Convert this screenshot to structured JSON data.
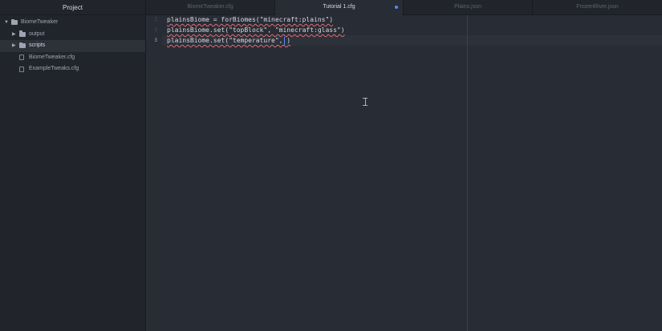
{
  "sidebar": {
    "title": "Project",
    "tree": [
      {
        "label": "BiomeTweaker",
        "type": "folder",
        "expanded": true,
        "depth": 0,
        "icon": "folder-icon"
      },
      {
        "label": "output",
        "type": "folder",
        "expanded": false,
        "depth": 1,
        "icon": "folder-icon"
      },
      {
        "label": "scripts",
        "type": "folder",
        "expanded": false,
        "depth": 1,
        "icon": "folder-icon",
        "selected": true
      },
      {
        "label": "BiomeTweaker.cfg",
        "type": "file",
        "depth": 1,
        "icon": "file-text-icon"
      },
      {
        "label": "ExampleTweaks.cfg",
        "type": "file",
        "depth": 1,
        "icon": "file-text-icon"
      }
    ]
  },
  "tabs": [
    {
      "label": "BiomeTweaker.cfg",
      "active": false,
      "modified": false
    },
    {
      "label": "Tutorial 1.cfg",
      "active": true,
      "modified": true
    },
    {
      "label": "Plains.json",
      "active": false,
      "modified": false
    },
    {
      "label": "FrozenRiver.json",
      "active": false,
      "modified": false
    }
  ],
  "editor": {
    "current_line": 3,
    "lines": [
      {
        "number": "1",
        "text": "plainsBiome = forBiomes(\"minecraft:plains\")"
      },
      {
        "number": "2",
        "text": "plainsBiome.set(\"topBlock\", \"minecraft:glass\")"
      },
      {
        "number": "3",
        "text": "plainsBiome.set(\"temperature\", )"
      }
    ]
  },
  "colors": {
    "background": "#282c34",
    "sidebar": "#21252b",
    "text": "#d7dae0",
    "accent": "#568af2",
    "lint_underline": "#e06c75"
  }
}
